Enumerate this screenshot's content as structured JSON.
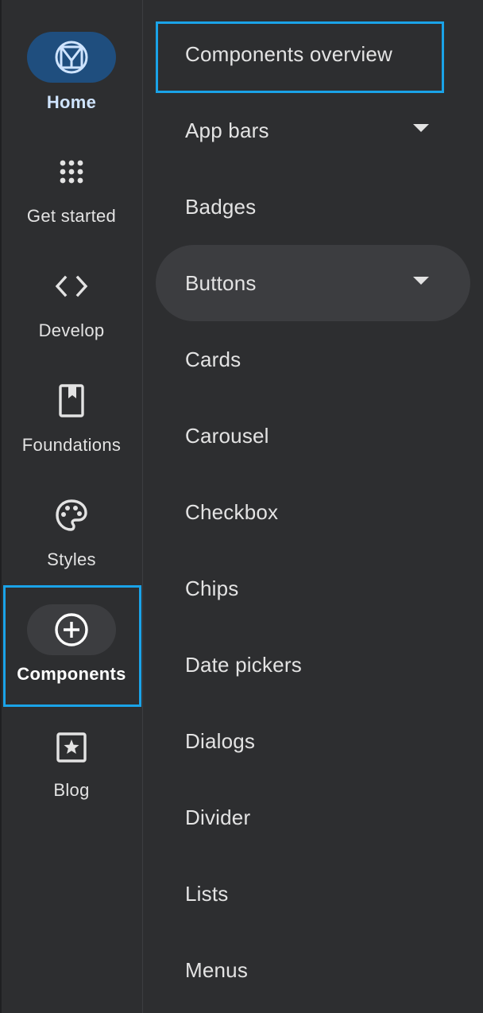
{
  "rail": {
    "items": [
      {
        "label": "Home",
        "icon": "material-logo-icon"
      },
      {
        "label": "Get started",
        "icon": "apps-grid-icon"
      },
      {
        "label": "Develop",
        "icon": "code-icon"
      },
      {
        "label": "Foundations",
        "icon": "bookmark-book-icon"
      },
      {
        "label": "Styles",
        "icon": "palette-icon"
      },
      {
        "label": "Components",
        "icon": "add-circle-icon"
      },
      {
        "label": "Blog",
        "icon": "star-box-icon"
      }
    ],
    "selected": "Home",
    "focused": "Components"
  },
  "drawer": {
    "items": [
      {
        "label": "Components overview"
      },
      {
        "label": "App bars",
        "expandable": true
      },
      {
        "label": "Badges"
      },
      {
        "label": "Buttons",
        "expandable": true
      },
      {
        "label": "Cards"
      },
      {
        "label": "Carousel"
      },
      {
        "label": "Checkbox"
      },
      {
        "label": "Chips"
      },
      {
        "label": "Date pickers"
      },
      {
        "label": "Dialogs"
      },
      {
        "label": "Divider"
      },
      {
        "label": "Lists"
      },
      {
        "label": "Menus"
      }
    ],
    "highlighted": "Buttons",
    "focused": "Components overview"
  },
  "colors": {
    "background": "#2d2e30",
    "focus_ring": "#1aa3e8",
    "home_pill": "#1f4e7e",
    "selected_pill": "#3c3d40",
    "text": "#e3e3e3"
  }
}
